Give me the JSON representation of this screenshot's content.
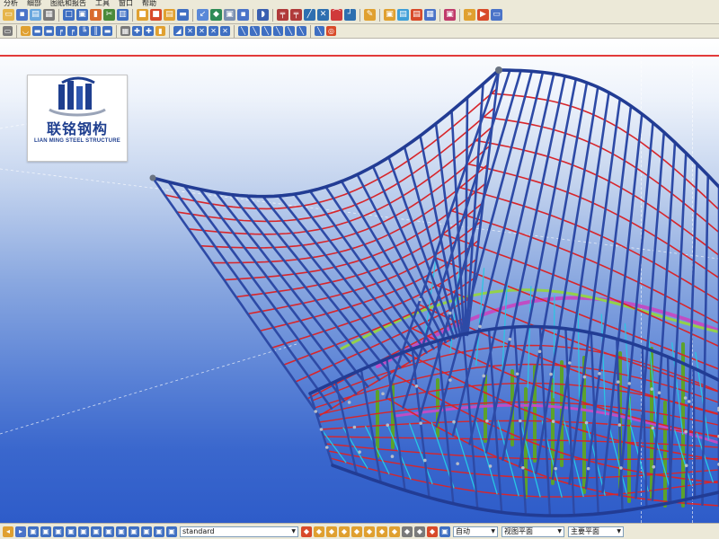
{
  "menu": {
    "items": [
      "分析",
      "细部",
      "图纸和报告",
      "工具",
      "窗口",
      "帮助"
    ]
  },
  "toolbar_top": {
    "icons": [
      "open-icon",
      "save-icon",
      "save-as-icon",
      "print-icon",
      "new-window-icon",
      "copy-icon",
      "paste-icon",
      "cut-icon",
      "properties-icon",
      "undo-icon",
      "redo-icon",
      "grid-icon",
      "beam-icon",
      "column-icon",
      "plate-icon",
      "bolt-icon",
      "weld-icon",
      "point-icon",
      "line-icon",
      "arc-icon",
      "measure-icon",
      "snap-icon",
      "component-icon",
      "macro-icon",
      "numbering-icon",
      "report-icon",
      "drawing-icon",
      "clash-icon",
      "forward-icon",
      "select-icon"
    ]
  },
  "toolbar_bottom": {
    "icons": [
      "select-all-icon",
      "select-part-icon",
      "select-assembly-icon",
      "select-bolt-icon",
      "select-weld-icon",
      "select-grid-icon",
      "select-point-icon",
      "select-view-icon",
      "snap-end-icon",
      "snap-mid-icon",
      "snap-intersect-icon",
      "snap-perp-icon",
      "snap-line-icon",
      "snap-center-icon",
      "snap-nearest-icon",
      "snap-free-icon"
    ]
  },
  "logo": {
    "chinese": "联铭钢构",
    "english": "LIAN MING STEEL STRUCTURE"
  },
  "statusbar": {
    "combo_standard": "standard",
    "combo_auto": "自动",
    "combo_view_plane": "视图平面",
    "combo_main_plane": "主要平面"
  },
  "colors": {
    "viewport_top": "#ffffff",
    "viewport_bottom": "#2e5cc9",
    "members_blue": "#2d4aa6",
    "bracing_red": "#d8252a",
    "columns_green": "#5ca22c",
    "ring_magenta": "#c04dc4",
    "cyan": "#27c7e3"
  }
}
